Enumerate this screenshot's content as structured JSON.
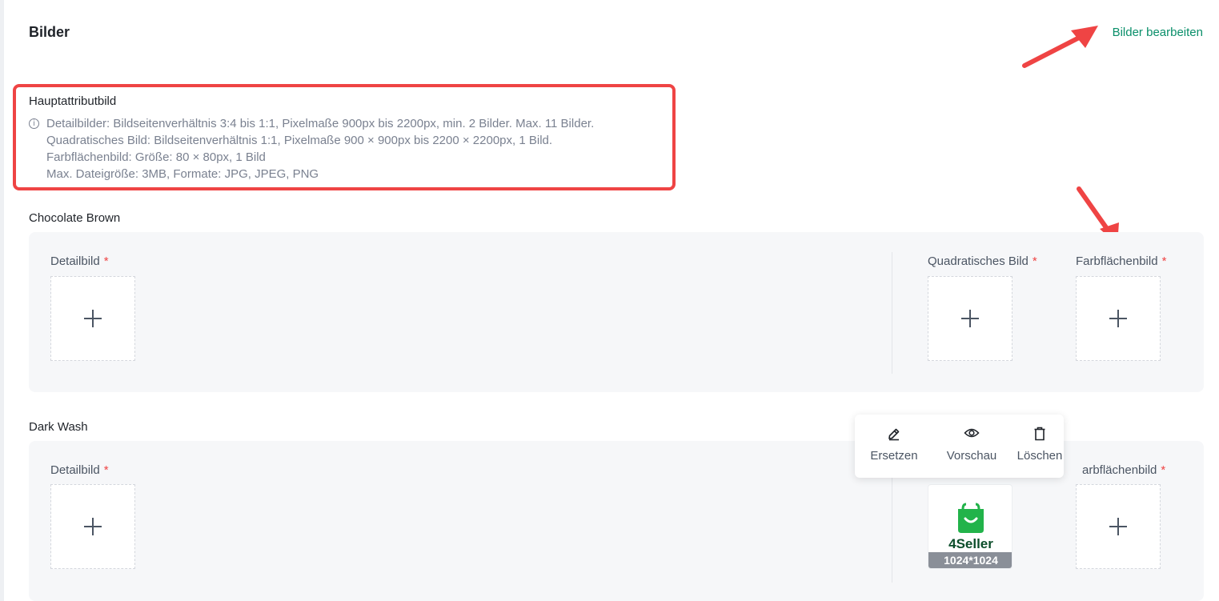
{
  "header": {
    "title": "Bilder",
    "edit_link": "Bilder bearbeiten"
  },
  "info": {
    "title": "Hauptattributbild",
    "lines": [
      "Detailbilder: Bildseitenverhältnis 3:4 bis 1:1, Pixelmaße 900px bis 2200px, min. 2 Bilder. Max. 11 Bilder.",
      "Quadratisches Bild: Bildseitenverhältnis 1:1, Pixelmaße 900 × 900px bis 2200 × 2200px, 1 Bild.",
      "Farbflächenbild: Größe: 80 × 80px, 1 Bild",
      "Max. Dateigröße: 3MB, Formate: JPG, JPEG, PNG"
    ]
  },
  "variants": [
    {
      "name": "Chocolate Brown",
      "detail_label": "Detailbild",
      "square_label": "Quadratisches Bild",
      "swatch_label": "Farbflächenbild",
      "required_mark": "*"
    },
    {
      "name": "Dark Wash",
      "detail_label": "Detailbild",
      "swatch_label": "arbflächenbild",
      "required_mark": "*",
      "square_image": {
        "brand": "4Seller",
        "dimensions": "1024*1024"
      }
    }
  ],
  "image_actions": {
    "replace": "Ersetzen",
    "preview": "Vorschau",
    "delete": "Löschen"
  },
  "icons": {
    "info": "info-circle-icon",
    "plus": "plus-icon",
    "edit": "pencil-icon",
    "preview": "eye-icon",
    "delete": "trash-icon",
    "brand_logo": "shopping-bag-icon"
  },
  "colors": {
    "accent_link": "#0a8f6a",
    "required": "#ef4444",
    "highlight_box": "#ef4444",
    "annotation_arrow": "#ef4444",
    "brand_green": "#22b34a",
    "panel_bg": "#f6f7f9"
  }
}
